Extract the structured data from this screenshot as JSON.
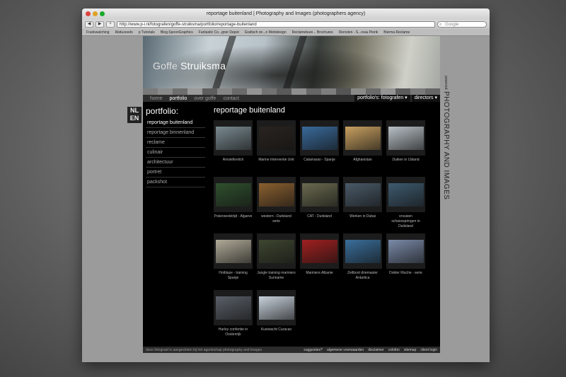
{
  "browser": {
    "window_title": "reportage buitenland | Photography and Images (photographers agency)",
    "url": "http://www.p-i.nl/fotografen/goffe-struiksma/portfolio/reportage-buitenland",
    "search_placeholder": "Google",
    "bookmarks": [
      "Frankwatching",
      "Abduzeedo",
      "p Tutorials",
      "Blog.SpoonGraphics",
      "Fantastic Co...gner Depot",
      "Grafisch on...n Webdesign",
      "Reclamebure... Brochures",
      "Diensten - S...reau Pierik",
      "Bierma Reclame"
    ]
  },
  "site": {
    "brand_first": "Goffe",
    "brand_last": "Struiksma",
    "lang_nl": "NL",
    "lang_en": "EN",
    "nav": [
      "home",
      "portfolio",
      "over goffe",
      "contact"
    ],
    "dropdown_portfolios": "portfolio's: fotografen",
    "dropdown_directors": "directors",
    "powered": "powered:",
    "tagline": "PHOTOGRAPHY AND IMAGES"
  },
  "sidebar": {
    "heading": "portfolio:",
    "links": [
      "reportage buitenland",
      "reportage binnenland",
      "reclame",
      "culinair",
      "architectuur",
      "portret",
      "packshot"
    ]
  },
  "main": {
    "title": "reportage buitenland",
    "thumbnails": [
      {
        "caption": "Amstellovitch",
        "color": "#7a8a90"
      },
      {
        "caption": "Marine Interventie Unit",
        "color": "#2a2420"
      },
      {
        "caption": "Catamaran - Spanje",
        "color": "#3a6a9a"
      },
      {
        "caption": "Afghanistan",
        "color": "#c8a060"
      },
      {
        "caption": "Duiken in IJsland",
        "color": "#b8c0c6"
      },
      {
        "caption": "Pokerwedstrijd - Algarve",
        "color": "#30502e"
      },
      {
        "caption": "western - Duitsland serie",
        "color": "#8a6030"
      },
      {
        "caption": "CAT - Duitsland",
        "color": "#6a6a50"
      },
      {
        "caption": "Werken in Dubai",
        "color": "#4a5a68"
      },
      {
        "caption": "vrouwen schansspringen in Duitsland",
        "color": "#3e5a6e"
      },
      {
        "caption": "Hotblaze - training Spanje",
        "color": "#b0aa98"
      },
      {
        "caption": "Jungle training mariniers Suriname",
        "color": "#3e4630"
      },
      {
        "caption": "Mariniers Albanie",
        "color": "#a02020"
      },
      {
        "caption": "Zeilboot driemaster Antartica",
        "color": "#3a6e9a"
      },
      {
        "caption": "Dokter Rische - serie",
        "color": "#7a8aa8"
      },
      {
        "caption": "Harley confentie in Oostenrijk",
        "color": "#5a6068"
      },
      {
        "caption": "Kustwacht Curacao",
        "color": "#c8d2dc"
      }
    ]
  },
  "footer": {
    "credit": "deze fotograaf is aangesloten bij het agentschap photography and images",
    "links": [
      "suggesties?",
      "algemene voorwaarden",
      "disclaimer",
      "colofon",
      "sitemap",
      "client login"
    ]
  }
}
